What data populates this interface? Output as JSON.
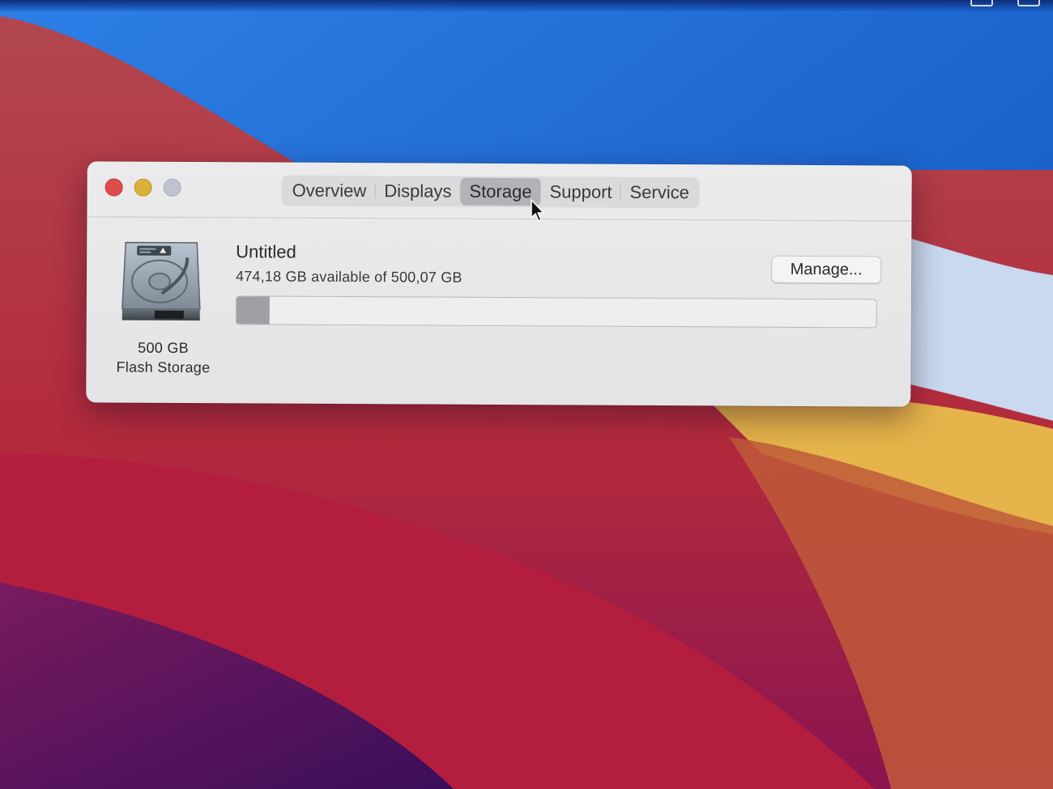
{
  "window": {
    "tabs": [
      {
        "label": "Overview"
      },
      {
        "label": "Displays"
      },
      {
        "label": "Storage"
      },
      {
        "label": "Support"
      },
      {
        "label": "Service"
      }
    ],
    "active_tab": "Storage"
  },
  "drive": {
    "icon": "hard-drive-icon",
    "capacity_label": "500 GB",
    "type_label": "Flash Storage"
  },
  "volume": {
    "name": "Untitled",
    "availability": "474,18 GB available of 500,07 GB",
    "used_fraction": 0.052,
    "manage_label": "Manage..."
  },
  "colors": {
    "close": "#de4d4a",
    "minimize": "#d9b23a",
    "zoom": "#bdc3cf",
    "storage_used": "#9fa0a6"
  }
}
